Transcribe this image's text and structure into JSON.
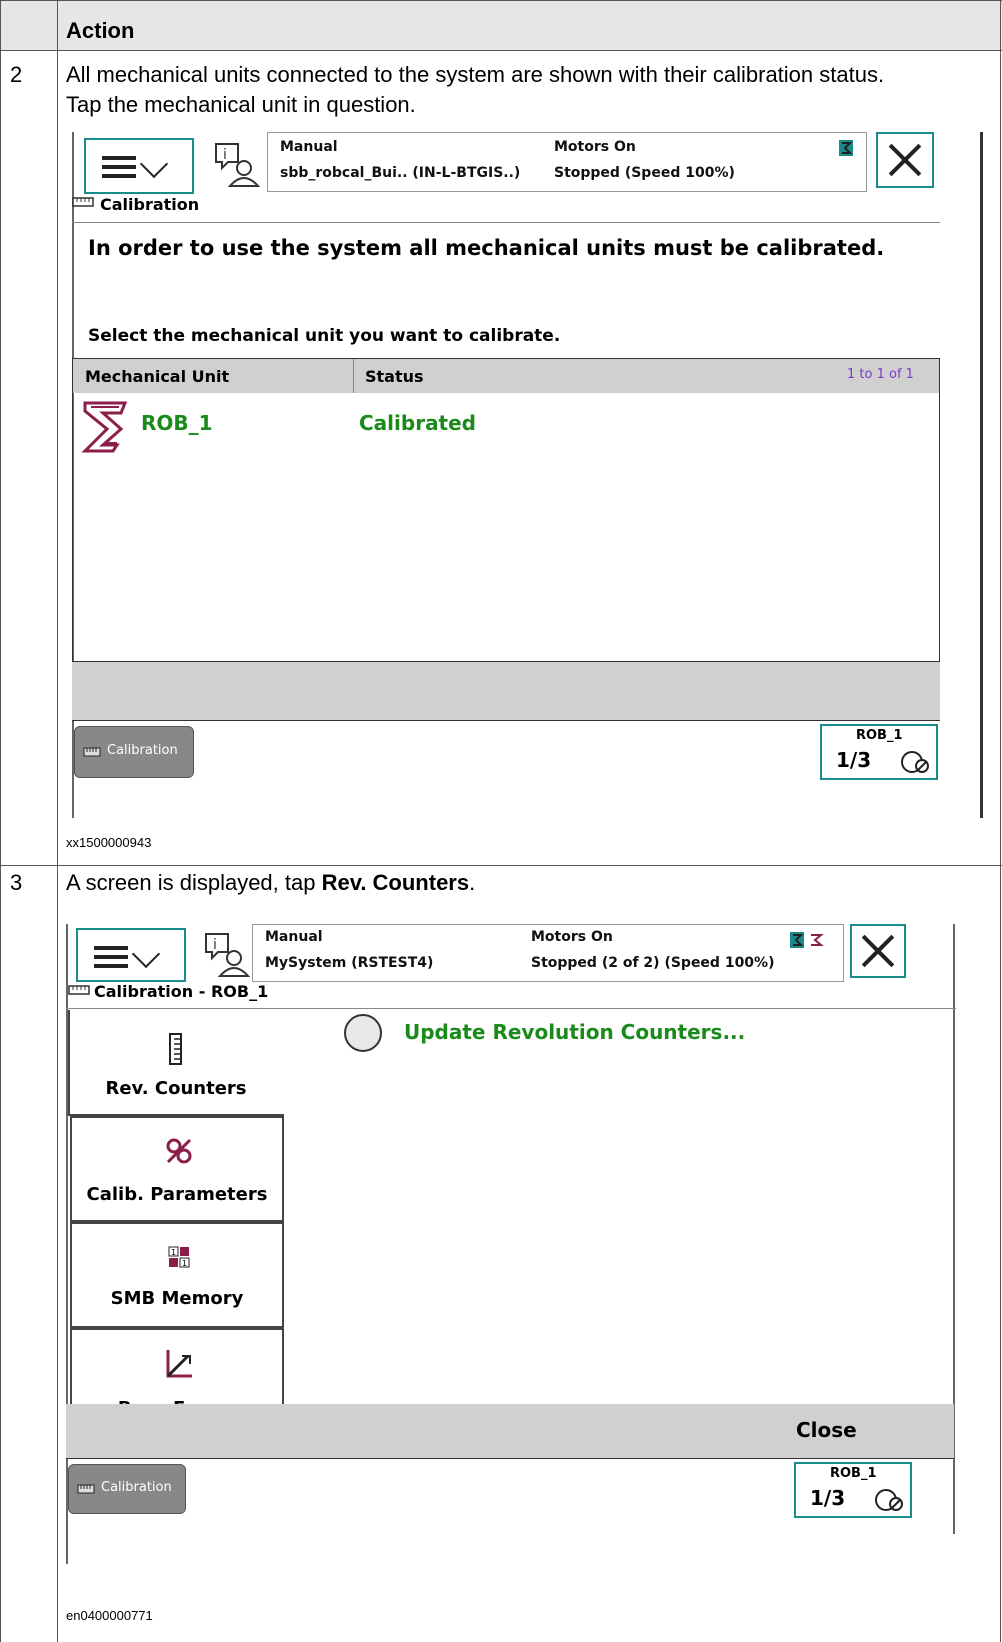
{
  "table": {
    "header": "Action",
    "rows": [
      {
        "step": "2",
        "text_line1": "All mechanical units connected to the system are shown with their calibration status.",
        "text_line2": "Tap the mechanical unit in question.",
        "figure_id": "xx1500000943"
      },
      {
        "step": "3",
        "text_prefix": "A screen is displayed, tap ",
        "text_bold": "Rev. Counters",
        "text_suffix": ".",
        "figure_id": "en0400000771"
      }
    ]
  },
  "screen1": {
    "status": {
      "mode": "Manual",
      "system": "sbb_robcal_Bui.. (IN-L-BTGIS..)",
      "motors": "Motors On",
      "state": "Stopped (Speed 100%)"
    },
    "app_title": "Calibration",
    "message": "In order to use the system all mechanical units must be calibrated.",
    "instruction": "Select the mechanical unit you want to calibrate.",
    "columns": [
      "Mechanical Unit",
      "Status"
    ],
    "paging": "1 to 1 of 1",
    "rows": [
      {
        "unit": "ROB_1",
        "status": "Calibrated"
      }
    ],
    "taskbar_label": "Calibration",
    "quickset": {
      "unit": "ROB_1",
      "fraction": "1/3"
    }
  },
  "screen2": {
    "status": {
      "mode": "Manual",
      "system": "MySystem (RSTEST4)",
      "motors": "Motors On",
      "state": "Stopped (2 of 2) (Speed 100%)"
    },
    "app_title": "Calibration - ROB_1",
    "tabs": [
      {
        "label": "Rev. Counters",
        "icon": "ruler-icon"
      },
      {
        "label": "Calib. Parameters",
        "icon": "gears-icon"
      },
      {
        "label": "SMB Memory",
        "icon": "binary-icon"
      },
      {
        "label": "Base Frame",
        "icon": "axes-icon"
      }
    ],
    "option_label": "Update Revolution Counters...",
    "close_label": "Close",
    "taskbar_label": "Calibration",
    "quickset": {
      "unit": "ROB_1",
      "fraction": "1/3"
    }
  },
  "colors": {
    "green_text": "#1a8a1a",
    "teal_border": "#1a8a8a",
    "maroon_icon": "#8a1f4a"
  }
}
